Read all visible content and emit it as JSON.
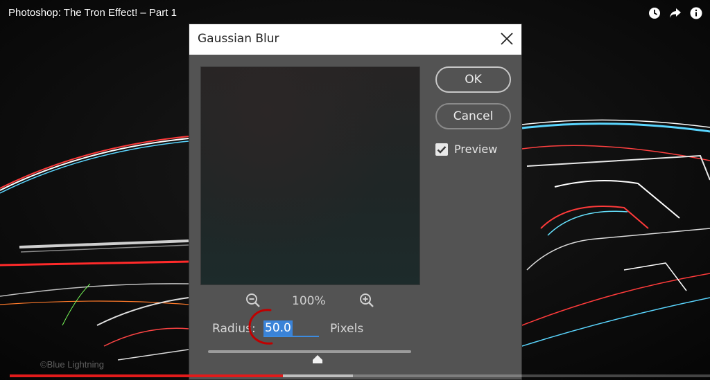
{
  "video": {
    "title": "Photoshop: The Tron Effect! – Part 1",
    "watermark": "©Blue Lightning",
    "played_fraction": 0.39,
    "buffered_fraction": 0.49,
    "icons": [
      "watch-later-icon",
      "share-icon",
      "info-icon"
    ]
  },
  "dialog": {
    "title": "Gaussian Blur",
    "ok_label": "OK",
    "cancel_label": "Cancel",
    "preview_label": "Preview",
    "preview_checked": true,
    "zoom_level": "100%",
    "radius_label": "Radius:",
    "radius_value": "50.0",
    "unit_label": "Pixels",
    "slider_fraction": 0.54
  },
  "colors": {
    "accent": "#3a83d8",
    "progress": "#e21b1b",
    "annotation": "#c00000"
  }
}
